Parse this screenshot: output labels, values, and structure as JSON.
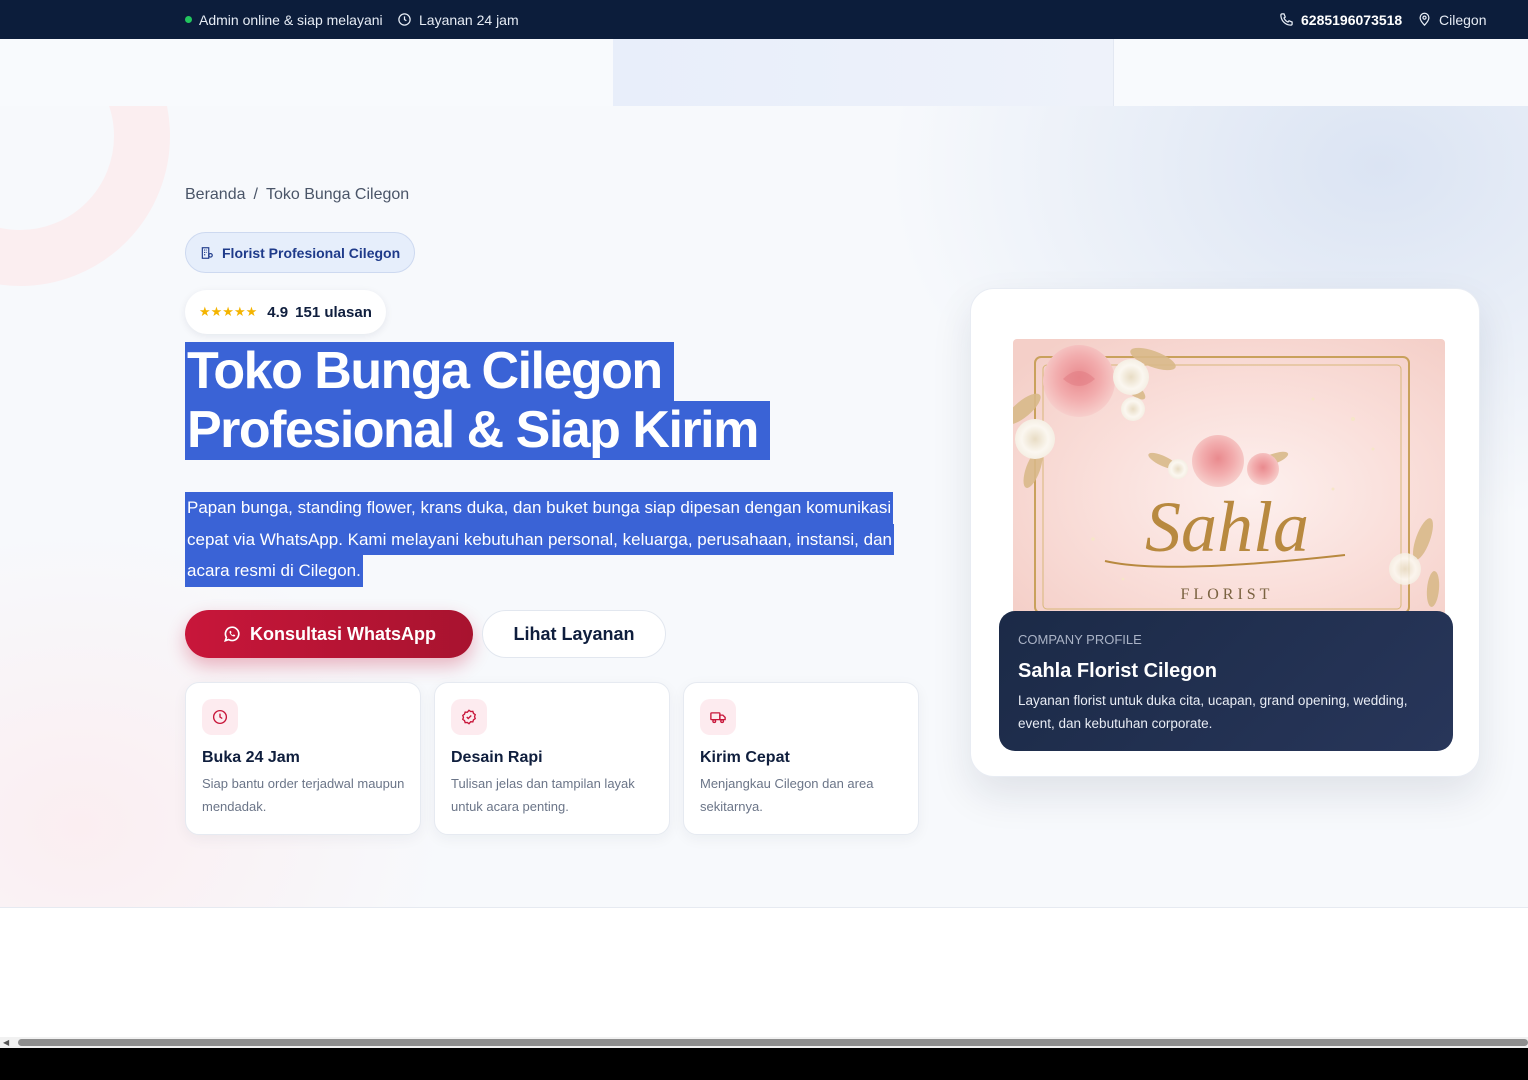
{
  "topbar": {
    "status": "Admin online & siap melayani",
    "hours": "Layanan 24 jam",
    "phone": "6285196073518",
    "location": "Cilegon"
  },
  "breadcrumb": {
    "home": "Beranda",
    "separator": "/",
    "current": "Toko Bunga Cilegon"
  },
  "hero": {
    "tag": "Florist Profesional Cilegon",
    "rating": {
      "stars": "★★★★★",
      "score": "4.9",
      "reviews": "151 ulasan"
    },
    "title_lines": [
      "Toko Bunga Cilegon",
      "Profesional & Siap Kirim"
    ],
    "lead_lines": [
      "Papan bunga, standing flower, krans duka, dan buket bunga siap dipesan dengan komunikasi",
      "cepat via WhatsApp. Kami melayani kebutuhan personal, keluarga, perusahaan, instansi, dan",
      "acara resmi di Cilegon."
    ],
    "cta_primary": "Konsultasi WhatsApp",
    "cta_secondary": "Lihat Layanan"
  },
  "features": [
    {
      "icon": "clock-icon",
      "title": "Buka 24 Jam",
      "desc": "Siap bantu order terjadwal maupun mendadak."
    },
    {
      "icon": "check-badge-icon",
      "title": "Desain Rapi",
      "desc": "Tulisan jelas dan tampilan layak untuk acara penting."
    },
    {
      "icon": "truck-icon",
      "title": "Kirim Cepat",
      "desc": "Menjangkau Cilegon dan area sekitarnya."
    }
  ],
  "profile_card": {
    "logo_text": "Sahla",
    "logo_sub": "FLORIST",
    "kicker": "COMPANY PROFILE",
    "title": "Sahla Florist Cilegon",
    "desc": "Layanan florist untuk duka cita, ucapan, grand opening, wedding, event, dan kebutuhan corporate."
  },
  "colors": {
    "topbar": "#0c1d3b",
    "accent_red": "#c8163a",
    "selection": "#3a63d6",
    "online": "#22c55e",
    "gold": "#b8893f"
  }
}
